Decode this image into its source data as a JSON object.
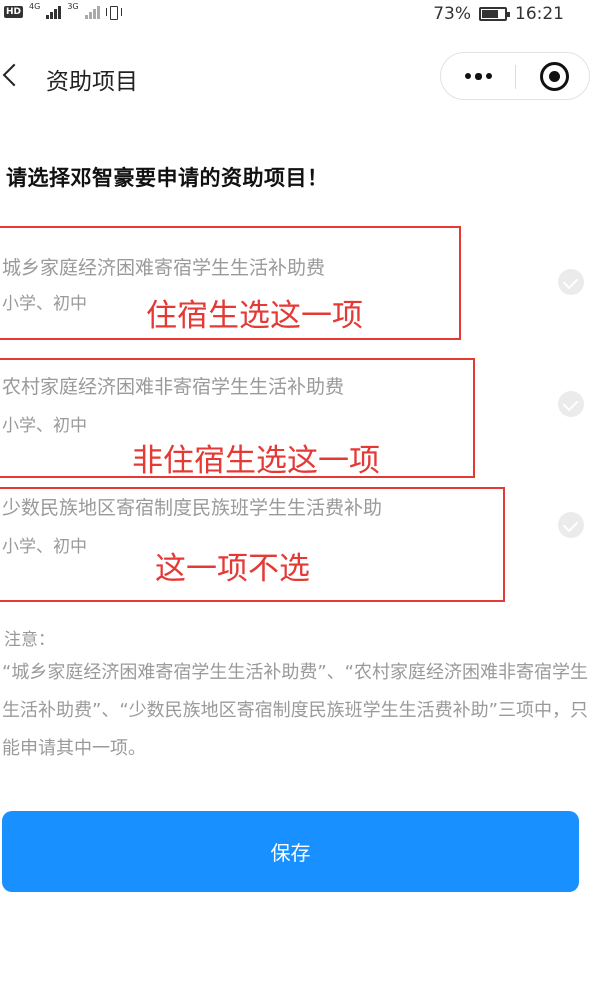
{
  "status_bar": {
    "hd": "HD",
    "network_1": "4G",
    "network_2": "3G",
    "battery_percent": "73%",
    "battery_level": 0.73,
    "time": "16:21"
  },
  "header": {
    "title": "资助项目"
  },
  "heading": "请选择邓智豪要申请的资助项目！",
  "options": [
    {
      "title": "城乡家庭经济困难寄宿学生生活补助费",
      "subtitle": "小学、初中",
      "annotation": "住宿生选这一项"
    },
    {
      "title": "农村家庭经济困难非寄宿学生生活补助费",
      "subtitle": "小学、初中",
      "annotation": "非住宿生选这一项"
    },
    {
      "title": "少数民族地区寄宿制度民族班学生生活费补助",
      "subtitle": "小学、初中",
      "annotation": "这一项不选"
    }
  ],
  "note": {
    "label": "注意：",
    "body": "“城乡家庭经济困难寄宿学生生活补助费”、“农村家庭经济困难非寄宿学生生活补助费”、“少数民族地区寄宿制度民族班学生生活费补助”三项中，只能申请其中一项。"
  },
  "save_label": "保存",
  "colors": {
    "accent": "#1890ff",
    "annotation": "#e53935",
    "muted_text": "#9a9a9a"
  }
}
